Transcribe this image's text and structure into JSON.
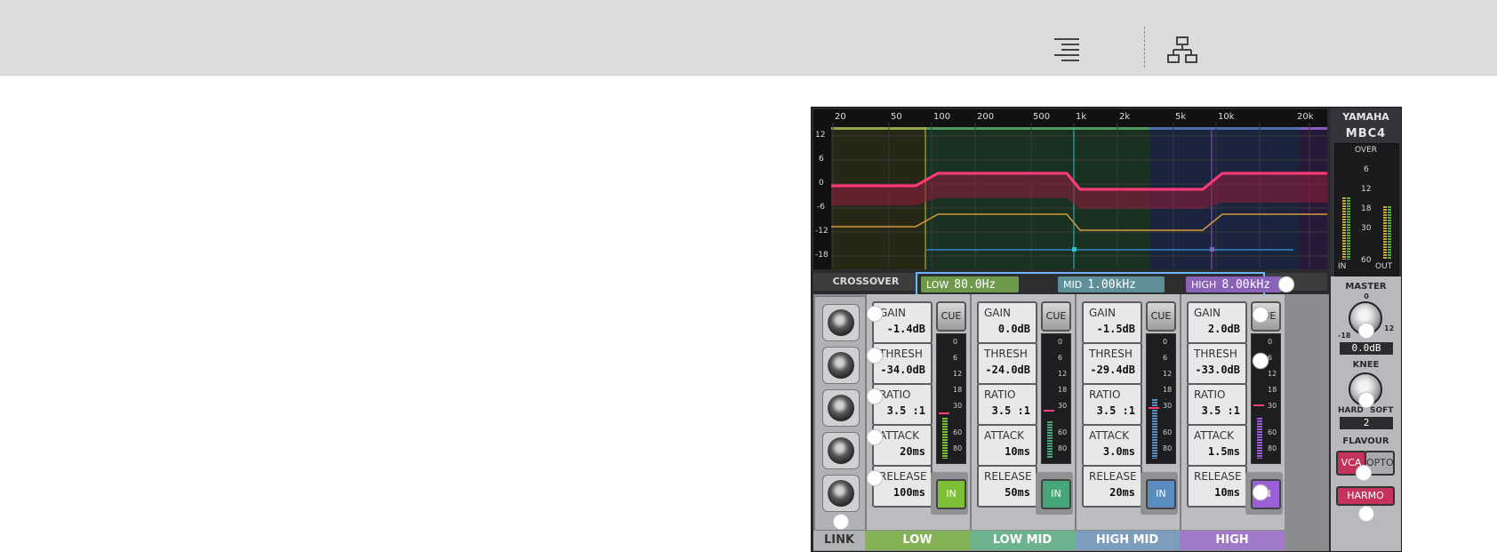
{
  "toolbar": {
    "icons": [
      "align-right-icon",
      "hierarchy-icon"
    ]
  },
  "graph": {
    "y_ticks": [
      "12",
      "6",
      "0",
      "-6",
      "-12",
      "-18"
    ],
    "x_ticks": [
      "20",
      "50",
      "100",
      "200",
      "500",
      "1k",
      "2k",
      "5k",
      "10k",
      "20k"
    ]
  },
  "crossover": {
    "label": "CROSSOVER",
    "low": {
      "name": "LOW",
      "value": "80.0Hz"
    },
    "mid": {
      "name": "MID",
      "value": "1.00kHz"
    },
    "high": {
      "name": "HIGH",
      "value": "8.00kHz"
    }
  },
  "brand": {
    "logo": "YAMAHA",
    "model": "MBC4"
  },
  "meter": {
    "scale": [
      "OVER",
      "6",
      "12",
      "18",
      "30",
      "60"
    ],
    "in_label": "IN",
    "out_label": "OUT"
  },
  "master": {
    "label": "MASTER",
    "zero": "0",
    "min": "-18",
    "max": "12",
    "value": "0.0dB"
  },
  "knee": {
    "label": "KNEE",
    "hard": "HARD",
    "soft": "SOFT",
    "value": "2"
  },
  "flavour": {
    "label": "FLAVOUR",
    "vca": "VCA",
    "opto": "OPTO",
    "harmo": "HARMO"
  },
  "link_label": "LINK",
  "param_labels": {
    "gain": "GAIN",
    "thresh": "THRESH",
    "ratio": "RATIO",
    "attack": "ATTACK",
    "release": "RELEASE"
  },
  "cue_label": "CUE",
  "in_label": "IN",
  "gr_scale": [
    "0",
    "6",
    "12",
    "18",
    "30",
    "60",
    "80"
  ],
  "bands": [
    {
      "name": "LOW",
      "gain": "-1.4dB",
      "thresh": "-34.0dB",
      "ratio": "3.5 :1",
      "attack": "20ms",
      "release": "100ms",
      "color": "#86b257",
      "in_color": "#7fbf35"
    },
    {
      "name": "LOW MID",
      "gain": "0.0dB",
      "thresh": "-24.0dB",
      "ratio": "3.5 :1",
      "attack": "10ms",
      "release": "50ms",
      "color": "#6db38e",
      "in_color": "#47a57a"
    },
    {
      "name": "HIGH MID",
      "gain": "-1.5dB",
      "thresh": "-29.4dB",
      "ratio": "3.5 :1",
      "attack": "3.0ms",
      "release": "20ms",
      "color": "#7d9dbe",
      "in_color": "#5b8cc0"
    },
    {
      "name": "HIGH",
      "gain": "2.0dB",
      "thresh": "-33.0dB",
      "ratio": "3.5 :1",
      "attack": "1.5ms",
      "release": "10ms",
      "color": "#a079c8",
      "in_color": "#9b5fd6"
    }
  ]
}
